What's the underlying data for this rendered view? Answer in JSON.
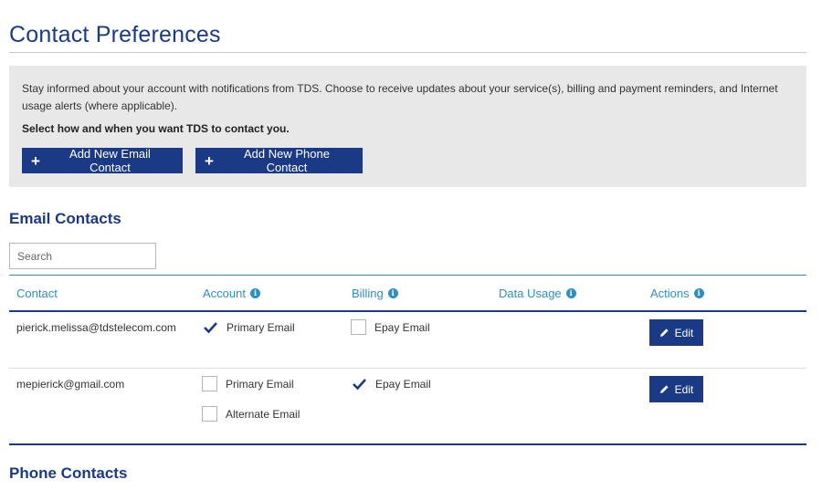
{
  "page": {
    "title": "Contact Preferences"
  },
  "intro": {
    "text": "Stay informed about your account with notifications from TDS. Choose to receive updates about your service(s), billing and payment reminders, and Internet usage alerts (where applicable).",
    "prompt": "Select how and when you want TDS to contact you.",
    "add_email_label": "Add New Email Contact",
    "add_phone_label": "Add New Phone Contact"
  },
  "email_section": {
    "title": "Email Contacts",
    "search_placeholder": "Search",
    "columns": [
      "Contact",
      "Account",
      "Billing",
      "Data Usage",
      "Actions"
    ],
    "rows": [
      {
        "contact": "pierick.melissa@tdstelecom.com",
        "account": [
          {
            "label": "Primary Email",
            "checked": true
          }
        ],
        "billing": [
          {
            "label": "Epay Email",
            "checked": false
          }
        ],
        "edit_label": "Edit"
      },
      {
        "contact": "mepierick@gmail.com",
        "account": [
          {
            "label": "Primary Email",
            "checked": false
          },
          {
            "label": "Alternate Email",
            "checked": false
          }
        ],
        "billing": [
          {
            "label": "Epay Email",
            "checked": true
          }
        ],
        "edit_label": "Edit"
      }
    ]
  },
  "phone_section": {
    "title": "Phone Contacts"
  },
  "colors": {
    "brand": "#1b3a86",
    "accent": "#2f8fbf",
    "panel": "#e8e8e8"
  },
  "icons": {
    "add": "plus-icon",
    "info": "info-icon",
    "edit": "pencil-icon",
    "checked": "check-icon"
  }
}
